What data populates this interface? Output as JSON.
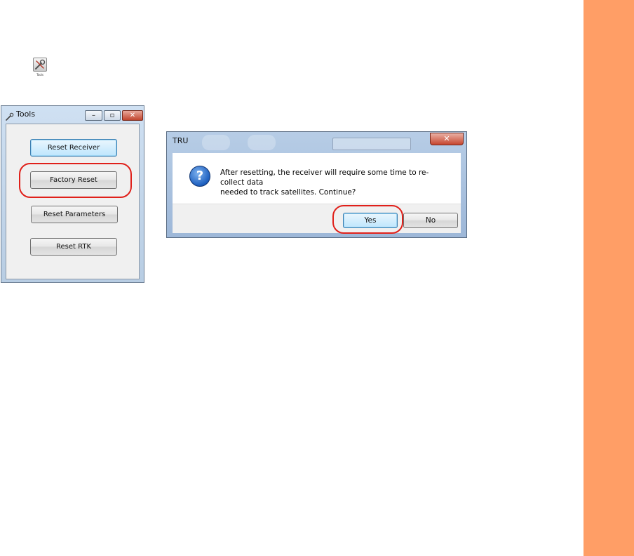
{
  "desktop": {
    "icon_caption": "Tools",
    "icon": "wrench-screwdriver-icon"
  },
  "tools_window": {
    "title": "Tools",
    "controls": {
      "minimize": "–",
      "maximize": "▫",
      "close": "✕"
    },
    "buttons": [
      "Reset Receiver",
      "Factory Reset",
      "Reset Parameters",
      "Reset RTK"
    ]
  },
  "dialog": {
    "title": "TRU",
    "close_glyph": "✕",
    "icon": "question-icon",
    "icon_glyph": "?",
    "message_line1": "After resetting, the receiver will require some time to re-collect data",
    "message_line2": "needed to track satellites. Continue?",
    "yes_label": "Yes",
    "no_label": "No"
  },
  "colors": {
    "accent_band": "#ff9e66",
    "highlight_ring": "#e0201a"
  }
}
